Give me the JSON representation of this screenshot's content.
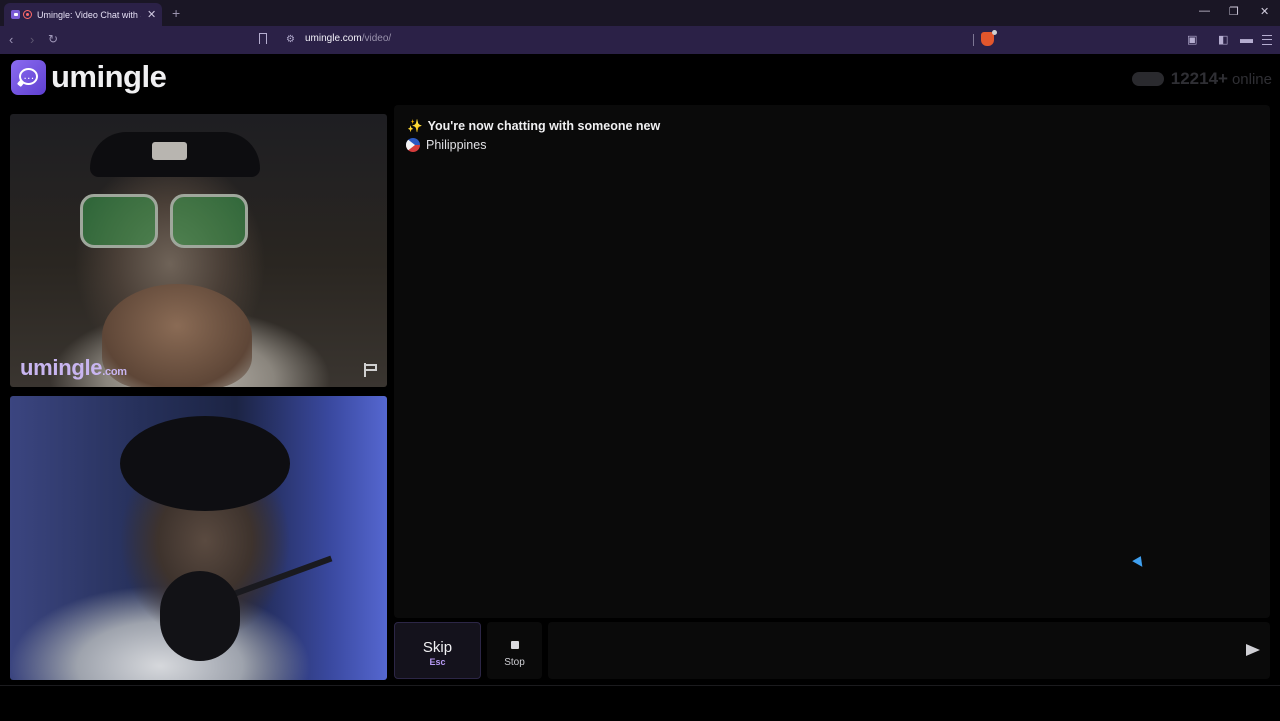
{
  "browser": {
    "tab_title": "Umingle: Video Chat with Str",
    "tab_close": "✕",
    "new_tab": "+",
    "url_host": "umingle.com",
    "url_path": "/video/",
    "window_minimize": "—",
    "window_restore": "❐",
    "window_close": "✕"
  },
  "header": {
    "logo_text": "umingle",
    "online_count": "12214+",
    "online_label": "online"
  },
  "stranger_video": {
    "watermark": "umingle",
    "watermark_suffix": ".com"
  },
  "chat": {
    "system_message": "You're now chatting with someone new",
    "country": "Philippines"
  },
  "controls": {
    "skip_label": "Skip",
    "skip_shortcut": "Esc",
    "stop_label": "Stop",
    "message_placeholder": ""
  },
  "colors": {
    "accent": "#7b5cd6",
    "tab_bg": "#2b2147",
    "skip_shortcut": "#b89bf5"
  }
}
